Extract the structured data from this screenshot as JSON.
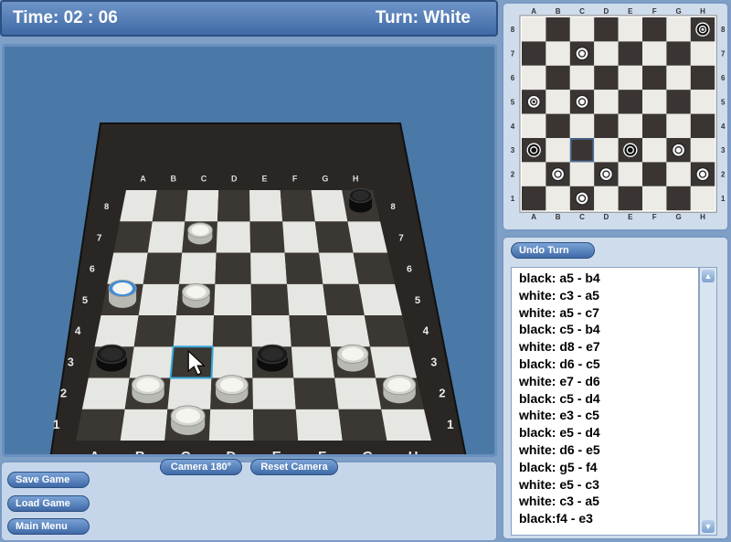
{
  "hud": {
    "time_label": "Time: 02 : 06",
    "turn_label": "Turn: White"
  },
  "board": {
    "files": [
      "A",
      "B",
      "C",
      "D",
      "E",
      "F",
      "G",
      "H"
    ],
    "ranks": [
      "1",
      "2",
      "3",
      "4",
      "5",
      "6",
      "7",
      "8"
    ],
    "colors": {
      "light": "#e6e6e2",
      "dark": "#3b3733",
      "frame": "#2a2624",
      "highlight": "#35a9d8",
      "selected_piece": "#3b8ddb"
    },
    "pieces": [
      {
        "square": "h8",
        "color": "black",
        "king": true
      },
      {
        "square": "c7",
        "color": "white",
        "king": false
      },
      {
        "square": "a5",
        "color": "white",
        "king": true,
        "selected": true
      },
      {
        "square": "c5",
        "color": "white",
        "king": false
      },
      {
        "square": "a3",
        "color": "black",
        "king": false
      },
      {
        "square": "e3",
        "color": "black",
        "king": false
      },
      {
        "square": "g3",
        "color": "white",
        "king": false
      },
      {
        "square": "b2",
        "color": "white",
        "king": false
      },
      {
        "square": "d2",
        "color": "white",
        "king": false
      },
      {
        "square": "h2",
        "color": "white",
        "king": false
      },
      {
        "square": "c1",
        "color": "white",
        "king": false
      }
    ],
    "highlight_square": "c3"
  },
  "minimap": {
    "files": [
      "A",
      "B",
      "C",
      "D",
      "E",
      "F",
      "G",
      "H"
    ],
    "ranks": [
      "8",
      "7",
      "6",
      "5",
      "4",
      "3",
      "2",
      "1"
    ],
    "highlight_square": "c3"
  },
  "camera": {
    "rotate_label": "Camera 180°",
    "reset_label": "Reset Camera"
  },
  "menu": {
    "save_label": "Save Game",
    "load_label": "Load Game",
    "main_label": "Main Menu"
  },
  "movelog": {
    "undo_label": "Undo Turn",
    "moves": [
      "black: a5 - b4",
      "white: c3 - a5",
      "white: a5 - c7",
      "black: c5 - b4",
      "white: d8 - e7",
      "black: d6 - c5",
      "white: e7 - d6",
      "black: c5 - d4",
      "white: e3 - c5",
      "black: e5 - d4",
      "white: d6 - e5",
      "black: g5 - f4",
      "white: e5 - c3",
      "white: c3 - a5",
      "black:f4 - e3"
    ],
    "scroll_up_icon": "triangle-up",
    "scroll_down_icon": "triangle-down"
  }
}
